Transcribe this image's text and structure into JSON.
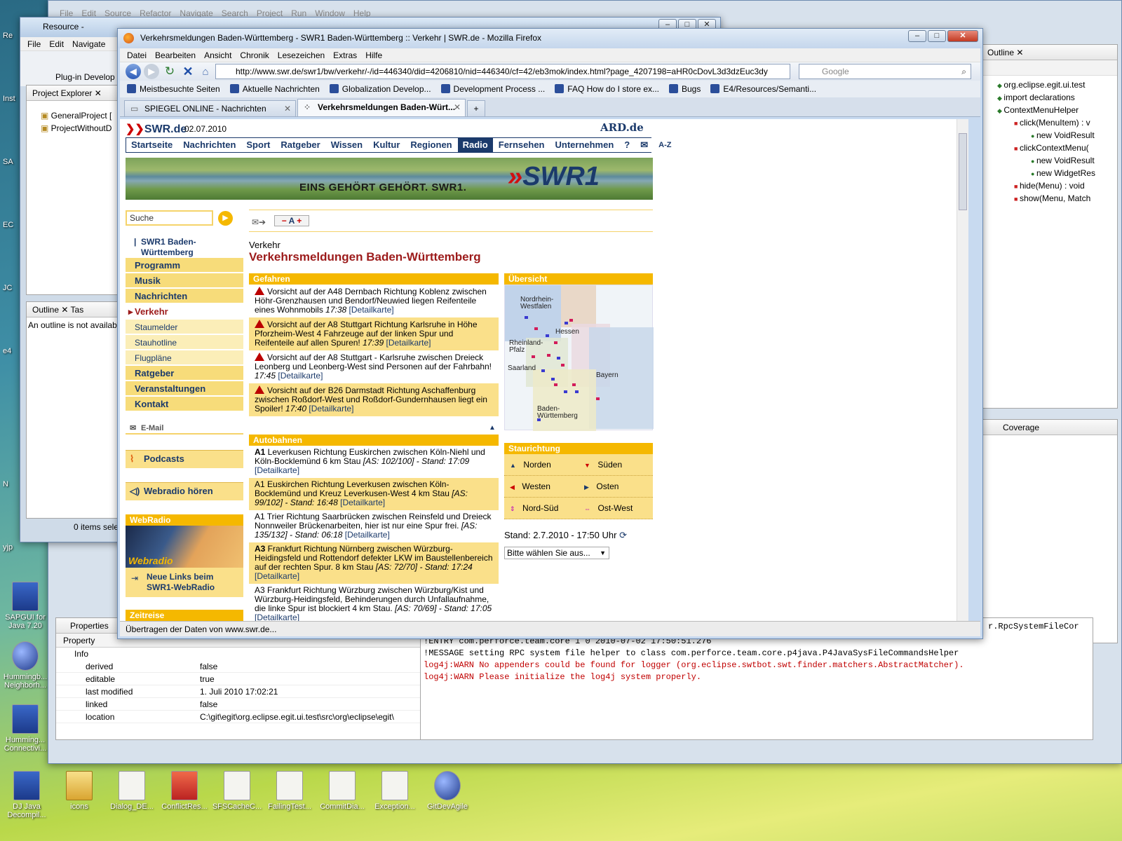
{
  "desktop": {
    "left_icons": [
      "Re",
      "Inst",
      "SA",
      "EC",
      "JC",
      "e4",
      "N",
      "yjp"
    ],
    "icons": [
      {
        "label": "SAPGUI for\nJava 7.20",
        "kind": "blue"
      },
      {
        "label": "Hummingb...\nNeighborh...",
        "kind": "globe"
      },
      {
        "label": "Humming...\nConnectivi...",
        "kind": "blue"
      }
    ],
    "bottom_icons": [
      {
        "label": "DJ Java\nDecompil...",
        "kind": "blue"
      },
      {
        "label": "icons",
        "kind": "folder"
      },
      {
        "label": "Dialog_DE...",
        "kind": "file"
      },
      {
        "label": "ConflictRes...",
        "kind": "red"
      },
      {
        "label": "SFSCacheC...",
        "kind": "file"
      },
      {
        "label": "FailingTest...",
        "kind": "file"
      },
      {
        "label": "CommitDia...",
        "kind": "file"
      },
      {
        "label": "Exception...",
        "kind": "file"
      },
      {
        "label": "GitDevAgile",
        "kind": "globe"
      }
    ]
  },
  "eclipse_back": {
    "menu": [
      "File",
      "Edit",
      "Source",
      "Refactor",
      "Navigate",
      "Search",
      "Project",
      "Run",
      "Window",
      "Help"
    ]
  },
  "resource_window": {
    "title": "Resource -",
    "menu": [
      "File",
      "Edit",
      "Navigate"
    ],
    "toolbar_label": "Plug-in Develop",
    "project_explorer": {
      "tab": "Project Explorer",
      "items": [
        "GeneralProject [",
        "ProjectWithoutD"
      ]
    },
    "outline": {
      "tab": "Outline",
      "tab2": "Tas",
      "message": "An outline is not availab"
    },
    "status": "0 items sele"
  },
  "outline_view": {
    "tab": "Outline",
    "items": [
      {
        "label": "org.eclipse.egit.ui.test",
        "indent": 0
      },
      {
        "label": "import declarations",
        "indent": 0
      },
      {
        "label": "ContextMenuHelper",
        "indent": 0
      },
      {
        "label": "click(MenuItem) : v",
        "indent": 1
      },
      {
        "label": "new VoidResult",
        "indent": 2
      },
      {
        "label": "clickContextMenu(",
        "indent": 1
      },
      {
        "label": "new VoidResult",
        "indent": 2
      },
      {
        "label": "new WidgetRes",
        "indent": 2
      },
      {
        "label": "hide(Menu) : void",
        "indent": 1
      },
      {
        "label": "show(Menu, Match",
        "indent": 1
      }
    ],
    "coverage_tab": "Coverage"
  },
  "properties": {
    "tab": "Properties",
    "header": "Property",
    "group": "Info",
    "rows": [
      {
        "key": "derived",
        "value": "false"
      },
      {
        "key": "editable",
        "value": "true"
      },
      {
        "key": "last modified",
        "value": "1. Juli 2010 17:02:21"
      },
      {
        "key": "linked",
        "value": "false"
      },
      {
        "key": "location",
        "value": "C:\\git\\egit\\org.eclipse.egit.ui.test\\src\\org\\eclipse\\egit\\"
      }
    ]
  },
  "console": {
    "partial": "r.RpcSystemFileCor",
    "lines": [
      {
        "text": "!ENTRY com.perforce.team.core 1 0 2010-07-02 17:50:51.276",
        "color": "#000000"
      },
      {
        "text": "!MESSAGE setting RPC system file helper to class com.perforce.team.core.p4java.P4JavaSysFileCommandsHelper",
        "color": "#000000"
      },
      {
        "text": "log4j:WARN No appenders could be found for logger (org.eclipse.swtbot.swt.finder.matchers.AbstractMatcher).",
        "color": "#c00000"
      },
      {
        "text": "log4j:WARN Please initialize the log4j system properly.",
        "color": "#c00000"
      }
    ]
  },
  "firefox": {
    "title": "Verkehrsmeldungen Baden-Württemberg - SWR1 Baden-Württemberg :: Verkehr | SWR.de - Mozilla Firefox",
    "menu": [
      "Datei",
      "Bearbeiten",
      "Ansicht",
      "Chronik",
      "Lesezeichen",
      "Extras",
      "Hilfe"
    ],
    "url": "http://www.swr.de/swr1/bw/verkehr/-/id=446340/did=4206810/nid=446340/cf=42/eb3mok/index.html?page_4207198=aHR0cDovL3d3dzEuc3dy",
    "search_engine": "Google",
    "bookmarks": [
      "Meistbesuchte Seiten",
      "Aktuelle Nachrichten",
      "Globalization Develop...",
      "Development Process ...",
      "FAQ How do I store ex...",
      "Bugs",
      "E4/Resources/Semanti..."
    ],
    "tabs": [
      {
        "label": "SPIEGEL ONLINE - Nachrichten"
      },
      {
        "label": "Verkehrsmeldungen Baden-Würt..."
      }
    ],
    "status": "Übertragen der Daten von www.swr.de..."
  },
  "swr": {
    "logo": "SWR.de",
    "date": "02.07.2010",
    "ard": "ARD.de",
    "nav": [
      "Startseite",
      "Nachrichten",
      "Sport",
      "Ratgeber",
      "Wissen",
      "Kultur",
      "Regionen",
      "Radio",
      "Fernsehen",
      "Unternehmen",
      "?"
    ],
    "nav_az": "A-Z",
    "banner_text": "EINS GEHÖRT GEHÖRT. SWR1.",
    "banner_logo": "SWR1",
    "search_placeholder": "Suche",
    "side_title": "SWR1 Baden-\nWürttemberg",
    "side_nav": [
      {
        "label": "Programm",
        "kind": "main"
      },
      {
        "label": "Musik",
        "kind": "main"
      },
      {
        "label": "Nachrichten",
        "kind": "main"
      },
      {
        "label": "Verkehr",
        "kind": "cur"
      },
      {
        "label": "Staumelder",
        "kind": "sub"
      },
      {
        "label": "Stauhotline",
        "kind": "sub"
      },
      {
        "label": "Flugpläne",
        "kind": "sub"
      },
      {
        "label": "Ratgeber",
        "kind": "main"
      },
      {
        "label": "Veranstaltungen",
        "kind": "main"
      },
      {
        "label": "Kontakt",
        "kind": "main"
      }
    ],
    "email": "E-Mail",
    "podcasts": "Podcasts",
    "webradio_hoeren": "Webradio hören",
    "webradio_head": "WebRadio",
    "webradio_img": "Webradio",
    "webradio_link": "Neue Links beim\nSWR1-WebRadio",
    "zeitreise": "Zeitreise",
    "font_tool": "A",
    "breadcrumb": "Verkehr",
    "heading": "Verkehrsmeldungen Baden-Württemberg",
    "gefahren_head": "Gefahren",
    "gefahren": [
      {
        "text": "Vorsicht auf der A48 Dernbach Richtung Koblenz zwischen Höhr-Grenzhausen und Bendorf/Neuwied liegen Reifenteile eines Wohnmobils ",
        "time": "17:38",
        "link": "[Detailkarte]"
      },
      {
        "text": "Vorsicht auf der A8 Stuttgart Richtung Karlsruhe in Höhe Pforzheim-West 4 Fahrzeuge auf der linken Spur und Reifenteile auf allen Spuren! ",
        "time": "17:39",
        "link": "[Detailkarte]"
      },
      {
        "text": "Vorsicht auf der A8 Stuttgart - Karlsruhe zwischen Dreieck Leonberg und Leonberg-West sind Personen auf der Fahrbahn! ",
        "time": "17:45",
        "link": "[Detailkarte]"
      },
      {
        "text": "Vorsicht auf der B26 Darmstadt Richtung Aschaffenburg zwischen Roßdorf-West und Roßdorf-Gundernhausen liegt ein Spoiler! ",
        "time": "17:40",
        "link": "[Detailkarte]"
      }
    ],
    "autobahnen_head": "Autobahnen",
    "autobahnen": [
      {
        "road": "A1",
        "text": " Leverkusen Richtung Euskirchen zwischen Köln-Niehl und Köln-Bocklemünd 6 km Stau ",
        "info": "[AS: 102/100] - Stand: 17:09",
        "link": "[Detailkarte]"
      },
      {
        "road": "",
        "text": "A1 Euskirchen Richtung Leverkusen zwischen Köln-Bocklemünd und Kreuz Leverkusen-West 4 km Stau ",
        "info": "[AS: 99/102] - Stand: 16:48",
        "link": "[Detailkarte]"
      },
      {
        "road": "",
        "text": "A1 Trier Richtung Saarbrücken zwischen Reinsfeld und Dreieck Nonnweiler Brückenarbeiten, hier ist nur eine Spur frei. ",
        "info": "[AS: 135/132] - Stand: 06:18",
        "link": "[Detailkarte]"
      },
      {
        "road": "A3",
        "text": " Frankfurt Richtung Nürnberg zwischen Würzburg-Heidingsfeld und Rottendorf defekter LKW im Baustellenbereich auf der rechten Spur. 8 km Stau ",
        "info": "[AS: 72/70] - Stand: 17:24",
        "link": "[Detailkarte]"
      },
      {
        "road": "",
        "text": "A3 Frankfurt Richtung Würzburg zwischen Würzburg/Kist und Würzburg-Heidingsfeld, Behinderungen durch Unfallaufnahme, die linke Spur ist blockiert 4 km Stau. ",
        "info": "[AS: 70/69] - Stand: 17:05",
        "link": "[Detailkarte]"
      }
    ],
    "uebersicht_head": "Übersicht",
    "map_labels": [
      "Nordrhein-\nWestfalen",
      "Hessen",
      "Rheinland-\nPfalz",
      "Saarland",
      "Bayern",
      "Baden-\nWürttemberg"
    ],
    "staurichtung_head": "Staurichtung",
    "directions": [
      [
        "Norden",
        "Süden"
      ],
      [
        "Westen",
        "Osten"
      ],
      [
        "Nord-Süd",
        "Ost-West"
      ]
    ],
    "stand": "Stand: 2.7.2010 - 17:50 Uhr",
    "select_value": "Bitte wählen Sie aus..."
  },
  "colors": {
    "swr_blue": "#1b3a6b",
    "swr_yellow": "#f5b800",
    "swr_light": "#fae08a",
    "swr_red": "#9c1b1b"
  }
}
